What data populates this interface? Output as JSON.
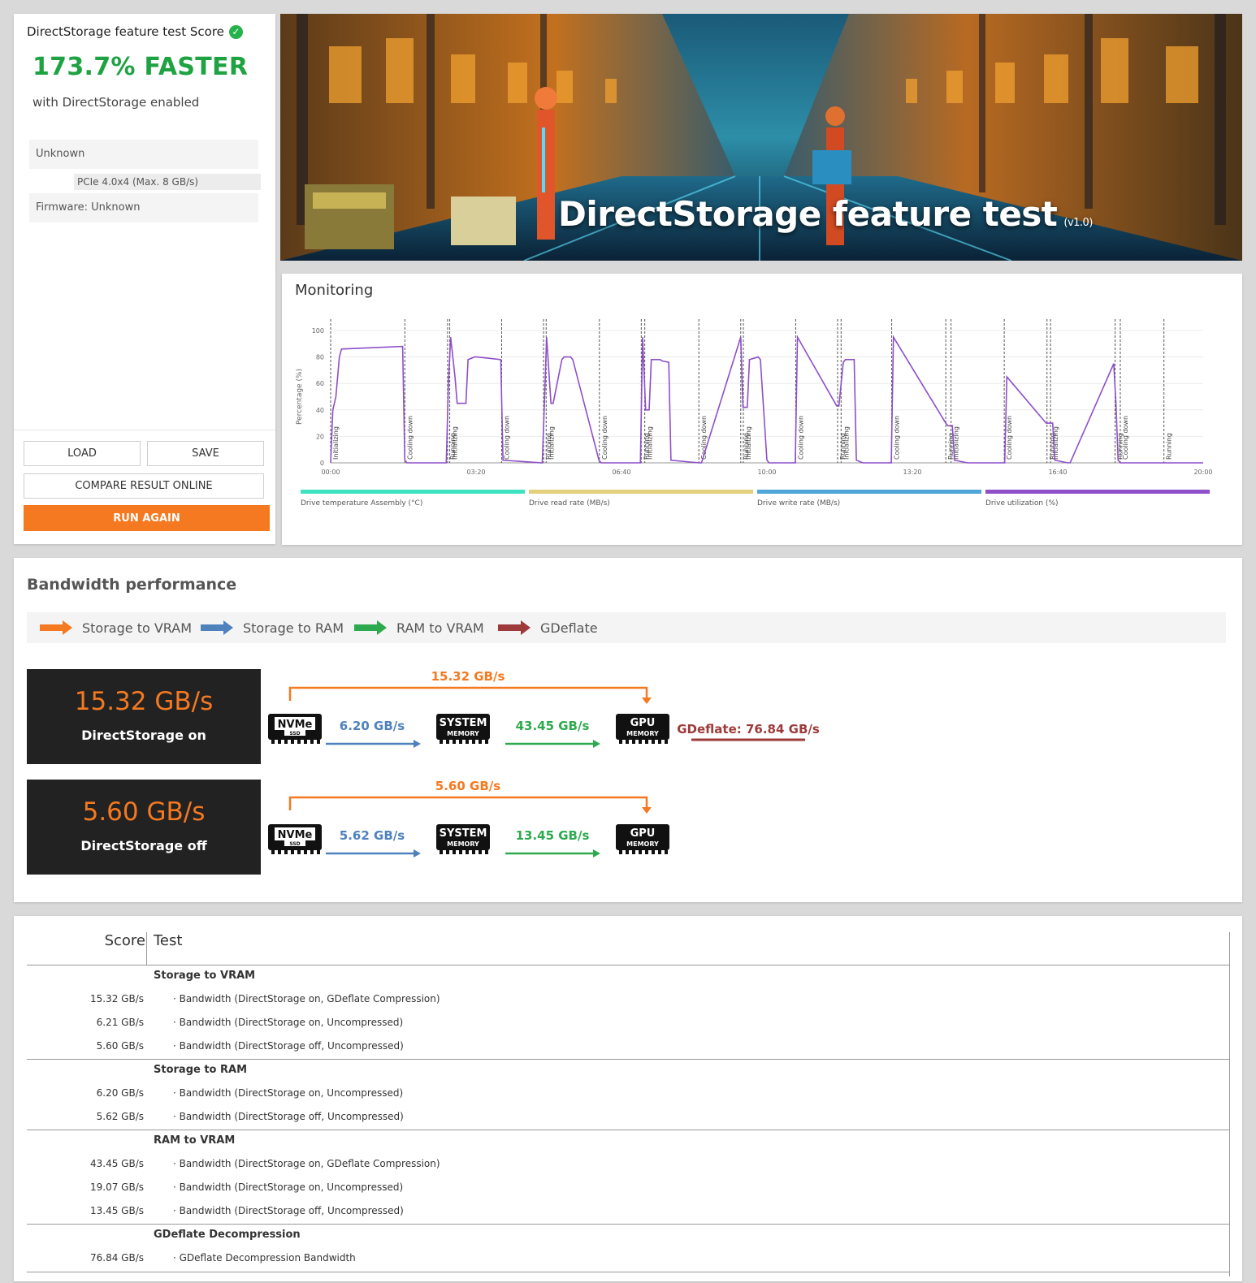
{
  "score_panel": {
    "title": "DirectStorage feature test Score",
    "headline": "173.7% FASTER",
    "subtitle": "with DirectStorage enabled",
    "drive_name": "Unknown",
    "drive_interface": "PCIe 4.0x4 (Max. 8 GB/s)",
    "firmware": "Firmware: Unknown",
    "buttons": {
      "load": "LOAD",
      "save": "SAVE",
      "compare": "COMPARE RESULT ONLINE",
      "run_again": "RUN AGAIN"
    },
    "accent_green": "#1fa342",
    "accent_orange": "#f47920"
  },
  "hero": {
    "title": "DirectStorage feature test",
    "version": "(v1.0)"
  },
  "monitoring": {
    "title": "Monitoring",
    "ylabel": "Percentage (%)",
    "yticks": [
      "0",
      "20",
      "40",
      "60",
      "80",
      "100"
    ],
    "xticks": [
      "00:00",
      "03:20",
      "06:40",
      "10:00",
      "13:20",
      "16:40",
      "20:00"
    ],
    "markers": [
      {
        "t": 0.0,
        "label": "Initializing"
      },
      {
        "t": 1.7,
        "label": "Cooling down"
      },
      {
        "t": 2.68,
        "label": "Running"
      },
      {
        "t": 2.73,
        "label": "Initializing"
      },
      {
        "t": 3.92,
        "label": "Cooling down"
      },
      {
        "t": 4.88,
        "label": "Running"
      },
      {
        "t": 4.94,
        "label": "Initializing"
      },
      {
        "t": 6.16,
        "label": "Cooling down"
      },
      {
        "t": 7.12,
        "label": "Running"
      },
      {
        "t": 7.2,
        "label": "Initializing"
      },
      {
        "t": 8.44,
        "label": "Cooling down"
      },
      {
        "t": 9.4,
        "label": "Running"
      },
      {
        "t": 9.46,
        "label": "Initializing"
      },
      {
        "t": 10.66,
        "label": "Cooling down"
      },
      {
        "t": 11.62,
        "label": "Running"
      },
      {
        "t": 11.7,
        "label": "Initializing"
      },
      {
        "t": 12.86,
        "label": "Cooling down"
      },
      {
        "t": 14.1,
        "label": "Running"
      },
      {
        "t": 14.22,
        "label": "Initializing"
      },
      {
        "t": 15.44,
        "label": "Cooling down"
      },
      {
        "t": 16.42,
        "label": "Running"
      },
      {
        "t": 16.5,
        "label": "Initializing"
      },
      {
        "t": 17.98,
        "label": "Running"
      },
      {
        "t": 18.1,
        "label": "Cooling down"
      },
      {
        "t": 19.1,
        "label": "Running"
      }
    ],
    "legend": [
      {
        "name": "Drive temperature Assembly (°C)",
        "color": "#3fe3c2"
      },
      {
        "name": "Drive read rate (MB/s)",
        "color": "#e3cf7c"
      },
      {
        "name": "Drive write rate (MB/s)",
        "color": "#4ea6d9"
      },
      {
        "name": "Drive utilization (%)",
        "color": "#8e4fc9"
      }
    ],
    "util_color": "#8e4fc9"
  },
  "chart_data": {
    "type": "line",
    "title": "Monitoring",
    "xlabel": "",
    "ylabel": "Percentage (%)",
    "xlim": [
      "00:00",
      "20:00"
    ],
    "ylim": [
      0,
      100
    ],
    "grid": true,
    "legend_position": "bottom",
    "series": [
      {
        "name": "Drive utilization (%)",
        "x_minutes": [
          0,
          0.05,
          0.12,
          0.2,
          0.25,
          1.65,
          1.7,
          1.75,
          2.65,
          2.7,
          2.75,
          2.85,
          2.9,
          3.1,
          3.15,
          3.3,
          3.35,
          3.9,
          3.95,
          4.85,
          4.9,
          4.95,
          5.05,
          5.1,
          5.3,
          5.35,
          5.5,
          5.55,
          6.15,
          6.2,
          7.1,
          7.15,
          7.22,
          7.3,
          7.35,
          7.55,
          7.6,
          7.75,
          7.8,
          8.45,
          8.5,
          9.4,
          9.45,
          9.55,
          9.6,
          9.8,
          9.85,
          10.0,
          10.05,
          10.65,
          10.7,
          11.6,
          11.65,
          11.75,
          11.8,
          12.0,
          12.05,
          12.2,
          12.25,
          12.85,
          12.9,
          14.1,
          14.15,
          14.25,
          14.3,
          14.6,
          14.65,
          15.45,
          15.5,
          16.4,
          16.45,
          16.55,
          16.6,
          16.9,
          16.95,
          17.95,
          18.0,
          18.05,
          18.1,
          18.15,
          20.0
        ],
        "values": [
          0,
          40,
          50,
          80,
          86,
          88,
          2,
          0,
          0,
          60,
          95,
          65,
          45,
          45,
          78,
          80,
          80,
          78,
          2,
          0,
          45,
          95,
          45,
          45,
          78,
          80,
          80,
          78,
          2,
          0,
          0,
          95,
          40,
          40,
          78,
          78,
          77,
          76,
          2,
          0,
          0,
          95,
          42,
          42,
          78,
          80,
          78,
          2,
          0,
          0,
          95,
          43,
          43,
          76,
          78,
          78,
          2,
          0,
          0,
          0,
          95,
          30,
          28,
          28,
          2,
          0,
          0,
          0,
          65,
          30,
          30,
          30,
          2,
          0,
          0,
          75,
          45,
          2,
          0,
          0,
          0
        ]
      }
    ]
  },
  "bandwidth": {
    "title": "Bandwidth performance",
    "legend": [
      {
        "name": "Storage to VRAM",
        "color": "#f47920"
      },
      {
        "name": "Storage to RAM",
        "color": "#4f81bd"
      },
      {
        "name": "RAM to VRAM",
        "color": "#2eaa4e"
      },
      {
        "name": "GDeflate",
        "color": "#9e3a3a"
      }
    ],
    "on": {
      "value": "15.32 GB/s",
      "label": "DirectStorage on",
      "total": "15.32 GB/s",
      "storage_to_ram": "6.20 GB/s",
      "ram_to_vram": "43.45 GB/s",
      "gdeflate": "GDeflate: 76.84 GB/s"
    },
    "off": {
      "value": "5.60 GB/s",
      "label": "DirectStorage off",
      "total": "5.60 GB/s",
      "storage_to_ram": "5.62 GB/s",
      "ram_to_vram": "13.45 GB/s"
    },
    "chips": {
      "nvme_top": "NVMe",
      "nvme_bottom": "SSD",
      "sys_top": "SYSTEM",
      "sys_bottom": "MEMORY",
      "gpu_top": "GPU",
      "gpu_bottom": "MEMORY"
    }
  },
  "results": {
    "head_score": "Score",
    "head_test": "Test",
    "groups": [
      {
        "title": "Storage to VRAM",
        "rows": [
          {
            "score": "15.32 GB/s",
            "test": "· Bandwidth (DirectStorage on, GDeflate Compression)"
          },
          {
            "score": "6.21 GB/s",
            "test": "· Bandwidth (DirectStorage on, Uncompressed)"
          },
          {
            "score": "5.60 GB/s",
            "test": "· Bandwidth (DirectStorage off, Uncompressed)"
          }
        ]
      },
      {
        "title": "Storage to RAM",
        "rows": [
          {
            "score": "6.20 GB/s",
            "test": "· Bandwidth (DirectStorage on, Uncompressed)"
          },
          {
            "score": "5.62 GB/s",
            "test": "· Bandwidth (DirectStorage off, Uncompressed)"
          }
        ]
      },
      {
        "title": "RAM to VRAM",
        "rows": [
          {
            "score": "43.45 GB/s",
            "test": "· Bandwidth (DirectStorage on, GDeflate Compression)"
          },
          {
            "score": "19.07 GB/s",
            "test": "· Bandwidth (DirectStorage on, Uncompressed)"
          },
          {
            "score": "13.45 GB/s",
            "test": "· Bandwidth (DirectStorage off, Uncompressed)"
          }
        ]
      },
      {
        "title": "GDeflate Decompression",
        "rows": [
          {
            "score": "76.84 GB/s",
            "test": "· GDeflate Decompression Bandwidth"
          }
        ]
      }
    ]
  }
}
